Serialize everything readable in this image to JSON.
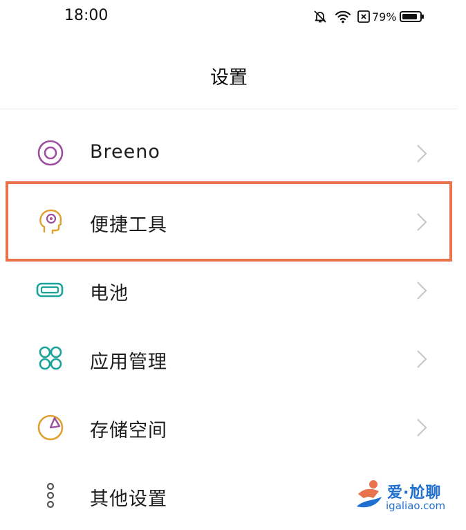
{
  "status_bar": {
    "time": "18:00",
    "battery_percent": "79%",
    "icons": [
      "bell-muted-icon",
      "wifi-icon",
      "sim-blocked-icon",
      "battery-icon"
    ]
  },
  "header": {
    "title": "设置"
  },
  "settings": {
    "items": [
      {
        "label": "Breeno",
        "icon": "breeno-ring-icon",
        "color": "#9b4f9e"
      },
      {
        "label": "便捷工具",
        "icon": "head-gear-icon",
        "color": "#e0a030"
      },
      {
        "label": "电池",
        "icon": "battery-outline-icon",
        "color": "#1aa39a"
      },
      {
        "label": "应用管理",
        "icon": "grid-apps-icon",
        "color": "#1aa39a"
      },
      {
        "label": "存储空间",
        "icon": "storage-pie-icon",
        "color": "#e0a030"
      },
      {
        "label": "其他设置",
        "icon": "more-dots-icon",
        "color": "#555555"
      }
    ],
    "highlighted_index": 1,
    "highlight_color": "#e8734c"
  },
  "watermark": {
    "title": "爱·尬聊",
    "url": "igaliao.com"
  }
}
